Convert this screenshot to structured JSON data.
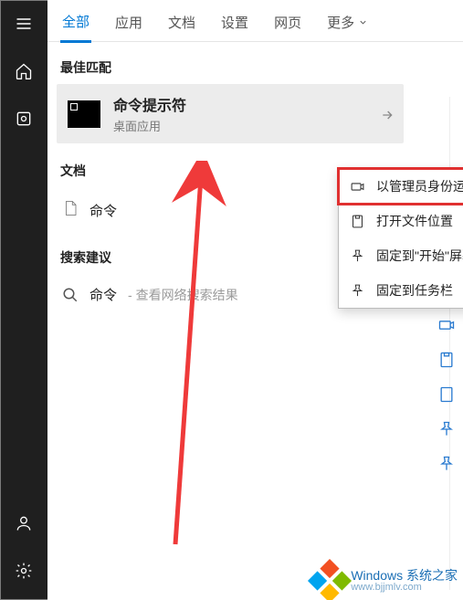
{
  "sidebar": {
    "top_icons": [
      "menu-icon",
      "home-icon",
      "collections-icon"
    ],
    "bottom_icons": [
      "account-icon",
      "settings-icon"
    ]
  },
  "tabs": {
    "items": [
      "全部",
      "应用",
      "文档",
      "设置",
      "网页"
    ],
    "more_label": "更多",
    "active_index": 0
  },
  "sections": {
    "best_match_label": "最佳匹配",
    "documents_label": "文档",
    "suggestions_label": "搜索建议"
  },
  "best_match": {
    "title": "命令提示符",
    "subtitle": "桌面应用"
  },
  "documents": {
    "items": [
      {
        "label": "命令"
      }
    ]
  },
  "suggestions": {
    "query": "命令",
    "hint": " - 查看网络搜索结果"
  },
  "context_menu": {
    "items": [
      {
        "icon": "run-admin-icon",
        "label": "以管理员身份运行",
        "highlight": true
      },
      {
        "icon": "open-location-icon",
        "label": "打开文件位置",
        "highlight": false
      },
      {
        "icon": "pin-start-icon",
        "label": "固定到\"开始\"屏幕",
        "highlight": false
      },
      {
        "icon": "pin-taskbar-icon",
        "label": "固定到任务栏",
        "highlight": false
      }
    ]
  },
  "right_strip_icons": [
    "run-admin-icon",
    "open-location-icon",
    "pin-start-icon",
    "pin-taskbar-icon"
  ],
  "watermark": {
    "line1": "Windows 系统之家",
    "line2": "www.bjjmlv.com"
  }
}
